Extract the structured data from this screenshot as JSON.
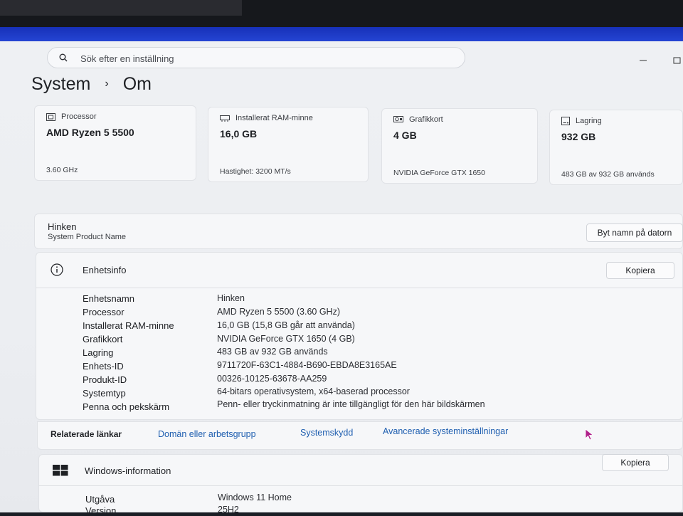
{
  "search": {
    "placeholder": "Sök efter en inställning"
  },
  "breadcrumb": {
    "parent": "System",
    "separator": "›",
    "current": "Om"
  },
  "specs": [
    {
      "label": "Processor",
      "value": "AMD Ryzen 5 5500",
      "detail": "3.60 GHz",
      "icon": "processor-icon"
    },
    {
      "label": "Installerat RAM-minne",
      "value": "16,0 GB",
      "detail": "Hastighet: 3200 MT/s",
      "icon": "ram-icon"
    },
    {
      "label": "Grafikkort",
      "value": "4 GB",
      "detail": "NVIDIA GeForce GTX 1650",
      "icon": "gpu-icon"
    },
    {
      "label": "Lagring",
      "value": "932 GB",
      "detail": "483 GB av 932 GB används",
      "icon": "storage-icon"
    }
  ],
  "device": {
    "name": "Hinken",
    "subtitle": "System Product Name",
    "rename_label": "Byt namn på datorn"
  },
  "device_info": {
    "title": "Enhetsinfo",
    "copy_label": "Kopiera",
    "rows": [
      {
        "label": "Enhetsnamn",
        "value": "Hinken"
      },
      {
        "label": "Processor",
        "value": "AMD Ryzen 5 5500 (3.60 GHz)"
      },
      {
        "label": "Installerat RAM-minne",
        "value": "16,0 GB (15,8 GB går att använda)"
      },
      {
        "label": "Grafikkort",
        "value": "NVIDIA GeForce GTX 1650 (4 GB)"
      },
      {
        "label": "Lagring",
        "value": "483 GB av 932 GB används"
      },
      {
        "label": "Enhets-ID",
        "value": "9711720F-63C1-4884-B690-EBDA8E3165AE"
      },
      {
        "label": "Produkt-ID",
        "value": "00326-10125-63678-AA259"
      },
      {
        "label": "Systemtyp",
        "value": "64-bitars operativsystem, x64-baserad processor"
      },
      {
        "label": "Penna och pekskärm",
        "value": "Penn- eller tryckinmatning är inte tillgängligt för den här bildskärmen"
      }
    ]
  },
  "related_links": {
    "label": "Relaterade länkar",
    "links": [
      "Domän eller arbetsgrupp",
      "Systemskydd",
      "Avancerade systeminställningar"
    ]
  },
  "windows_info": {
    "title": "Windows-information",
    "copy_label": "Kopiera",
    "rows": [
      {
        "label": "Utgåva",
        "value": "Windows 11 Home"
      },
      {
        "label": "Version",
        "value": "25H2"
      }
    ]
  },
  "colors": {
    "accent_link": "#1f5fb0",
    "taskbar_blue": "#2748d8"
  }
}
